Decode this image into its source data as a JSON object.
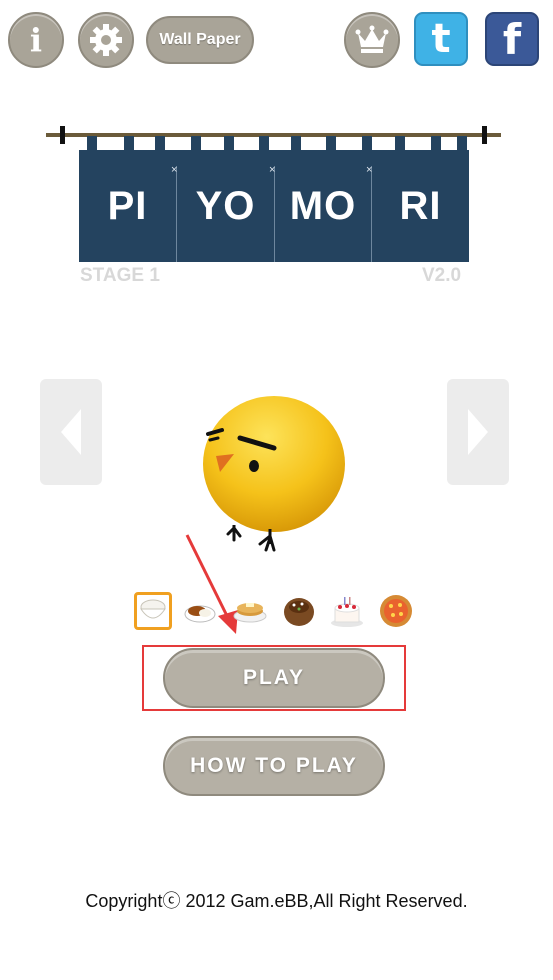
{
  "toolbar": {
    "info_label": "i",
    "wallpaper_label": "Wall Paper",
    "twitter_label": "t",
    "facebook_label": "f"
  },
  "title": {
    "panels": [
      "PI",
      "YO",
      "MO",
      "RI"
    ],
    "stage": "STAGE 1",
    "version": "V2.0"
  },
  "food_items": [
    "rice-bowl",
    "curry",
    "pancakes",
    "takoyaki",
    "cake",
    "pizza"
  ],
  "selected_food_index": 0,
  "buttons": {
    "play": "PLAY",
    "how_to_play": "HOW TO PLAY"
  },
  "copyright": "Copyrightⓒ 2012 Gam.eBB,All Right Reserved.",
  "colors": {
    "curtain": "#24435f",
    "button": "#a9a498",
    "twitter": "#3fb2e6",
    "facebook": "#3b5998",
    "highlight": "#e53a3a",
    "selection": "#f0a020"
  }
}
